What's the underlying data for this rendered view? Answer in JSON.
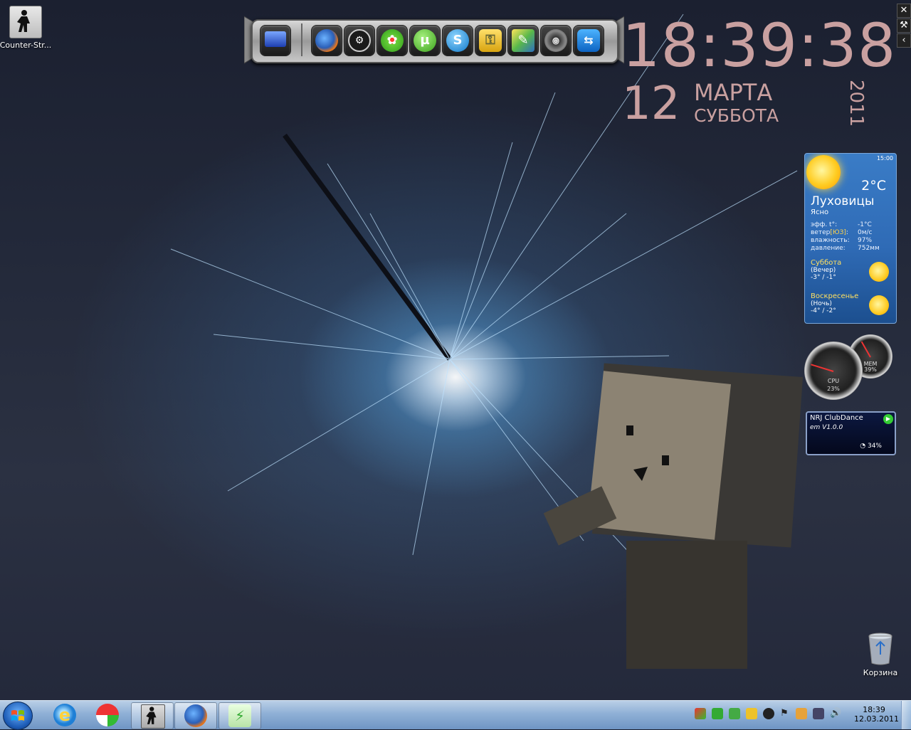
{
  "desktop": {
    "icons": [
      {
        "label": "Counter-Str..."
      },
      {
        "label": "Корзина"
      }
    ]
  },
  "dock": {
    "items": [
      "computer-icon",
      "firefox-icon",
      "steam-icon",
      "icq-icon",
      "utorrent-icon",
      "skype-icon",
      "icon-7",
      "icon-8",
      "icon-9",
      "teamviewer-icon"
    ]
  },
  "clock": {
    "time": "18:39:38",
    "day": "12",
    "month": "МАРТА",
    "weekday": "СУББОТА",
    "year": "2011"
  },
  "sidebar_controls": [
    "✕",
    "🔧",
    "‹"
  ],
  "weather": {
    "updated": "15:00",
    "temp": "2°C",
    "city": "Луховицы",
    "condition": "Ясно",
    "rows": [
      {
        "k": "эфф. t°:",
        "v": "-1°C"
      },
      {
        "k_pre": "ветер",
        "k_hl": "[ЮЗ]",
        "k_post": ":",
        "v": "0м/с"
      },
      {
        "k": "влажность:",
        "v": "97%"
      },
      {
        "k": "давление:",
        "v": "752мм"
      }
    ],
    "forecast": [
      {
        "day": "Суббота",
        "period": "(Вечер)",
        "temps": "-3° / -1°"
      },
      {
        "day": "Воскресенье",
        "period": "(Ночь)",
        "temps": "-4° / -2°"
      }
    ]
  },
  "meters": {
    "cpu_label": "CPU",
    "cpu_value": "23%",
    "cpu_fraction": 0.23,
    "mem_label": "MEM",
    "mem_value": "39%",
    "mem_fraction": 0.39
  },
  "radio": {
    "station": "NRJ ClubDance",
    "version": "em V1.0.0",
    "volume": "34%"
  },
  "taskbar": {
    "pinned": [
      "ie-icon",
      "gadget-icon",
      "counter-strike-icon",
      "firefox-icon",
      "winamp-icon"
    ],
    "time": "18:39",
    "date": "12.03.2011"
  },
  "colors": {
    "clock": "#c9a0a0",
    "weather_bg": "#2f6bb6",
    "taskbar": "#8fb0d6"
  }
}
